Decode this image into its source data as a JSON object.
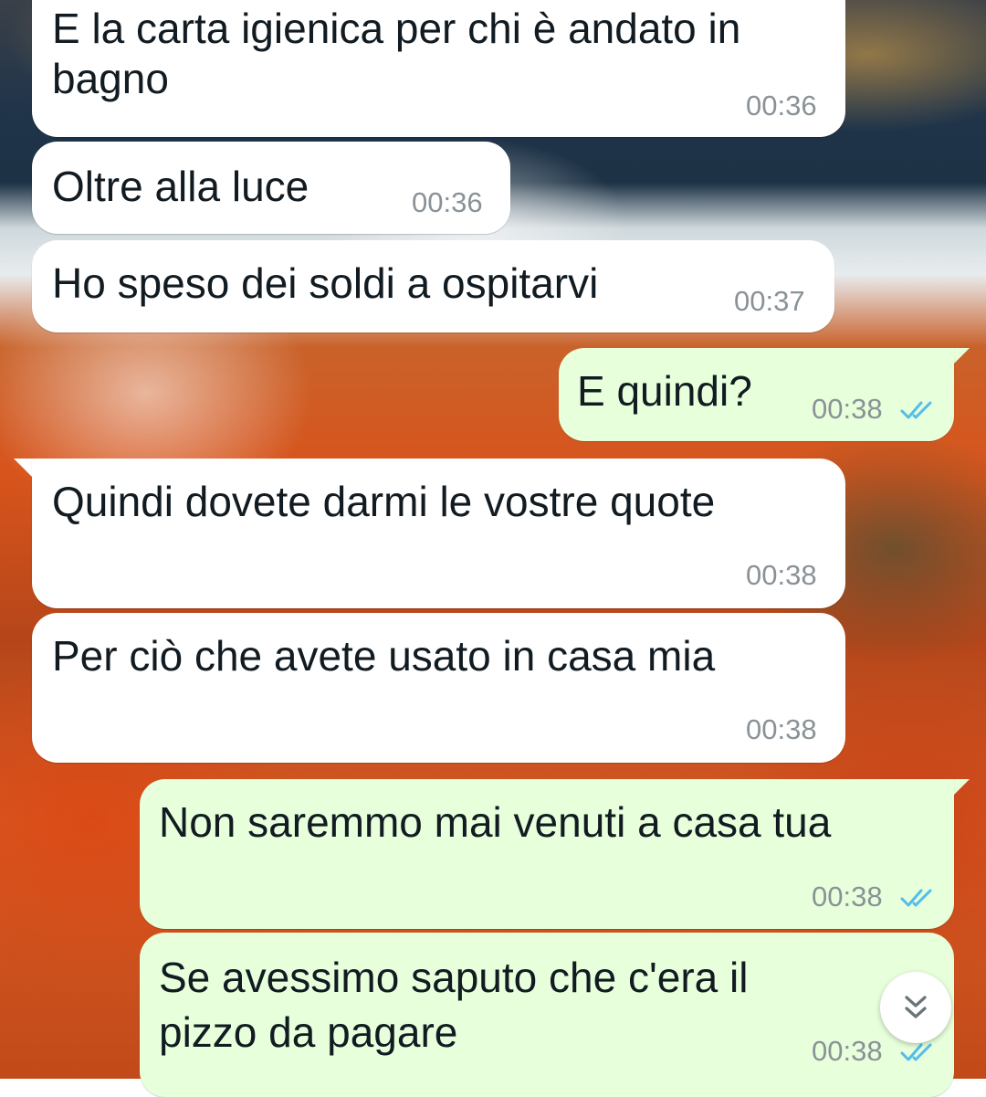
{
  "messages": [
    {
      "direction": "incoming",
      "lines": [
        "E la carta igienica per chi è andato in",
        "bagno"
      ],
      "time": "00:36"
    },
    {
      "direction": "incoming",
      "lines": [
        "Oltre alla luce"
      ],
      "time": "00:36"
    },
    {
      "direction": "incoming",
      "lines": [
        "Ho speso dei soldi a ospitarvi"
      ],
      "time": "00:37"
    },
    {
      "direction": "outgoing",
      "lines": [
        "E quindi?"
      ],
      "time": "00:38",
      "status": "read"
    },
    {
      "direction": "incoming",
      "lines": [
        "Quindi dovete darmi le vostre quote"
      ],
      "time": "00:38"
    },
    {
      "direction": "incoming",
      "lines": [
        "Per ciò che avete usato in casa mia"
      ],
      "time": "00:38"
    },
    {
      "direction": "outgoing",
      "lines": [
        "Non saremmo mai venuti a casa tua"
      ],
      "time": "00:38",
      "status": "read"
    },
    {
      "direction": "outgoing",
      "lines": [
        "Se avessimo saputo che c'era il",
        "pizzo da pagare"
      ],
      "time": "00:38",
      "status": "read"
    }
  ],
  "colors": {
    "incoming_bubble": "#ffffff",
    "outgoing_bubble": "#e7ffdb",
    "text": "#111b21",
    "timestamp": "#8a9297",
    "read_tick": "#53bdeb"
  },
  "icons": {
    "read_receipt": "double-check-icon",
    "scroll_down": "double-chevron-down-icon"
  }
}
